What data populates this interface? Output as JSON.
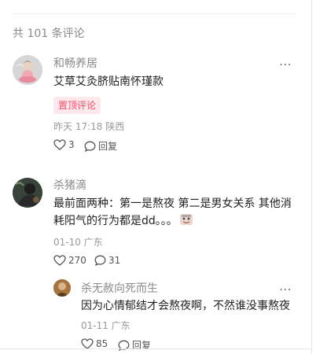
{
  "comment_count": "共 101 条评论",
  "more_icon": "⋯",
  "comments": [
    {
      "username": "和畅养居",
      "text": "艾草艾灸脐贴南怀瑾款",
      "badge": "置顶评论",
      "meta": "昨天 17:18 陕西",
      "like_count": "3",
      "reply_label": "回复",
      "avatar_icon": "person-meditating-avatar",
      "badge_color": "#f04f6a"
    },
    {
      "username": "杀猪滴",
      "text_line1": "最前面两种：第一是熬夜 第二是男女关系 其他消",
      "text_line2": "耗阳气的行为都是dd。。。",
      "sticker_icon": "emoji-sticker-icon",
      "meta": "01-10 广东",
      "like_count": "270",
      "comment_count": "31",
      "avatar_icon": "dark-photo-avatar"
    }
  ],
  "reply": {
    "username": "杀无赦向死而生",
    "text": "因为心情郁结才会熬夜啊，不然谁没事熬夜",
    "meta": "01-11 广东",
    "like_count": "85",
    "reply_label": "回复",
    "avatar_icon": "photo-avatar"
  }
}
